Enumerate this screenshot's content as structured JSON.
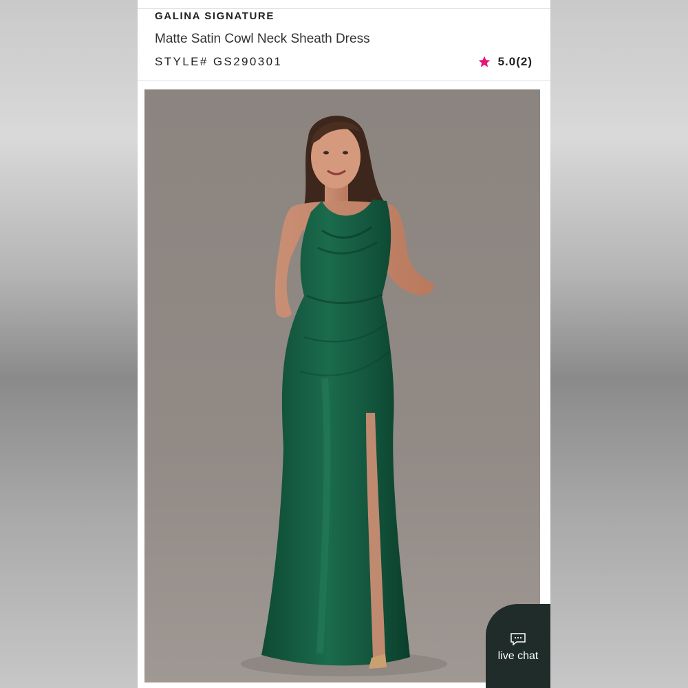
{
  "product": {
    "brand": "GALINA SIGNATURE",
    "title": "Matte Satin Cowl Neck Sheath Dress",
    "style": "STYLE# GS290301",
    "rating": "5.0(2)",
    "star_color": "#e6177a"
  },
  "chat": {
    "label": "live chat",
    "icon": "chat-bubble-icon"
  },
  "colors": {
    "dress": "#14583f",
    "chat_bg": "#1f2c2a"
  }
}
